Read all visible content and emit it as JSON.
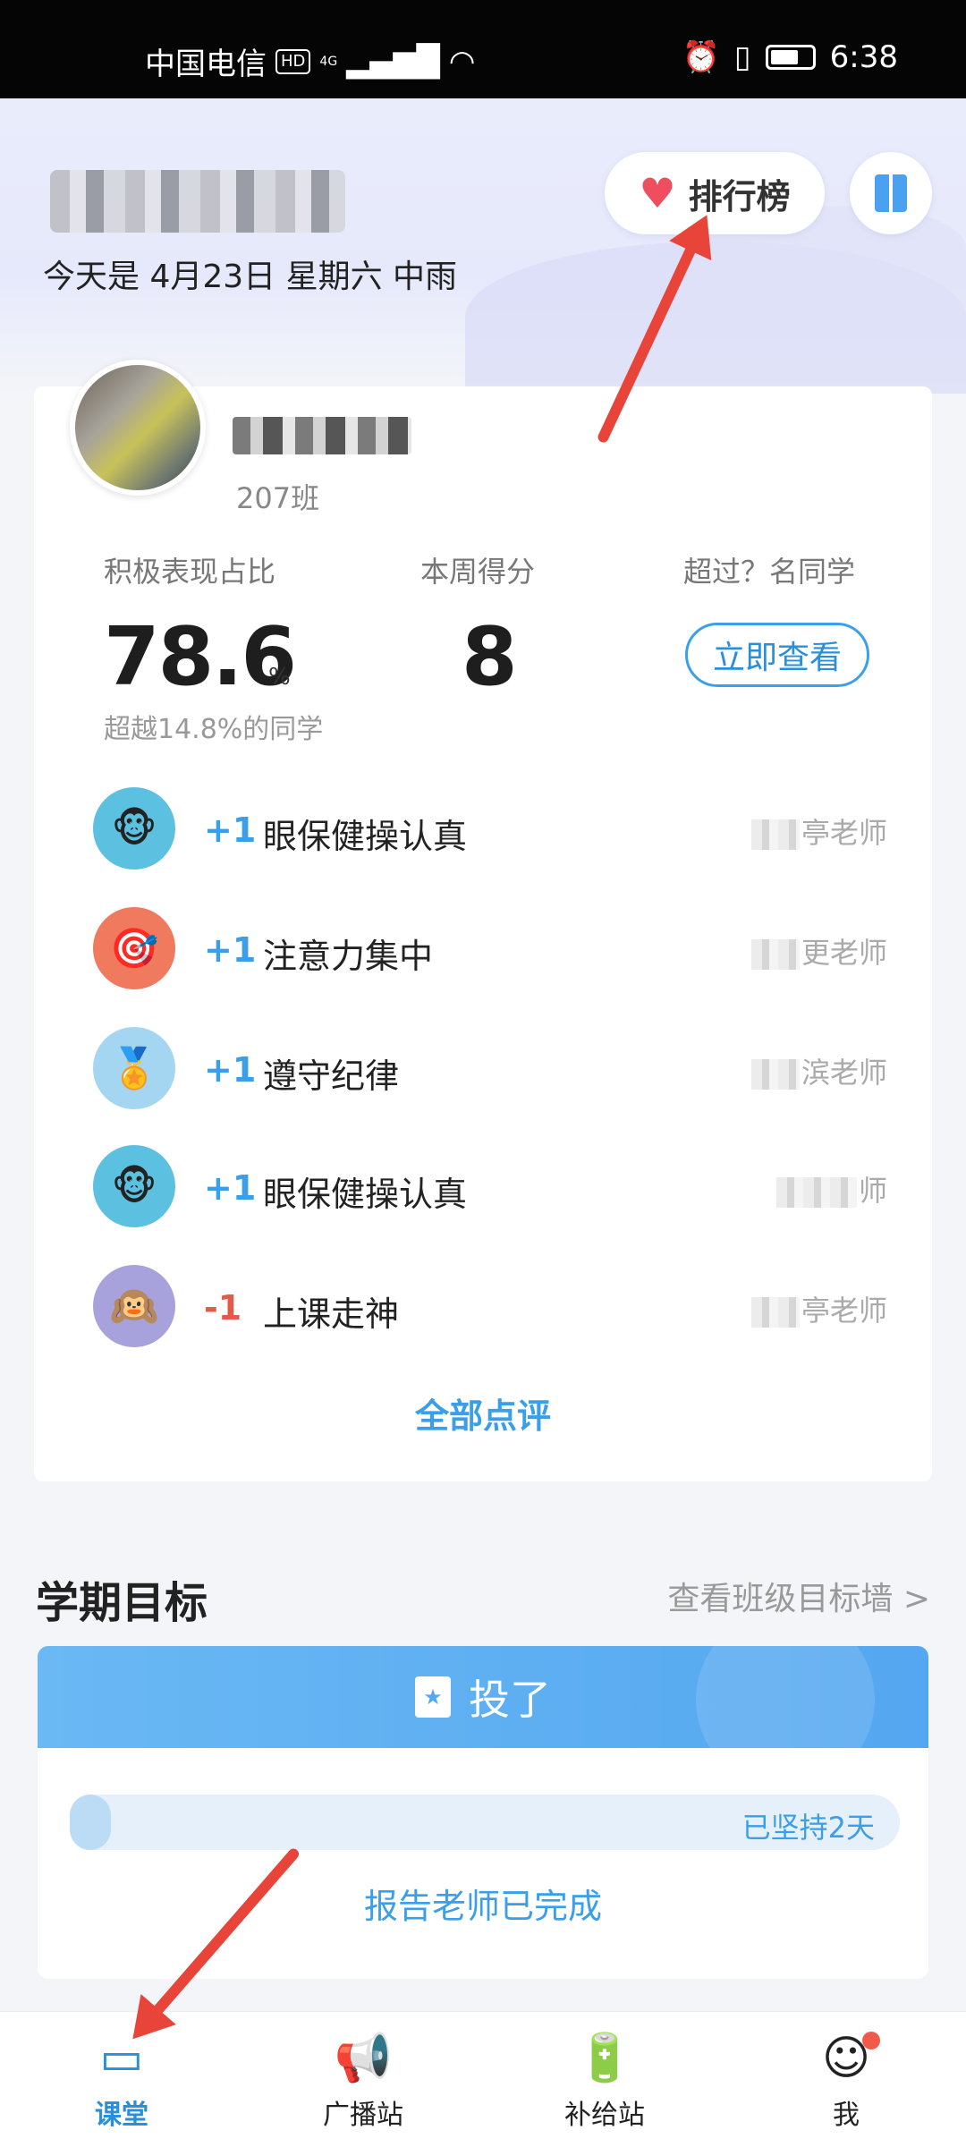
{
  "status_bar": {
    "carrier": "中国电信",
    "hd": "HD",
    "network": "4G",
    "time": "6:38"
  },
  "header": {
    "date_line": "今天是 4月23日 星期六 中雨",
    "ranking_label": "排行榜"
  },
  "profile": {
    "class_name": "207班"
  },
  "stats": {
    "ratio_title": "积极表现占比",
    "ratio_value": "78.6",
    "ratio_unit": "%",
    "ratio_sub": "超越14.8%的同学",
    "score_title": "本周得分",
    "score_value": "8",
    "exceed_title": "超过？名同学",
    "view_button": "立即查看"
  },
  "records": [
    {
      "score": "+1",
      "text": "眼保健操认真",
      "teacher_suffix": "亭老师",
      "icon": "monkey-icon"
    },
    {
      "score": "+1",
      "text": "注意力集中",
      "teacher_suffix": "更老师",
      "icon": "target-icon"
    },
    {
      "score": "+1",
      "text": "遵守纪律",
      "teacher_suffix": "滨老师",
      "icon": "medal-icon"
    },
    {
      "score": "+1",
      "text": "眼保健操认真",
      "teacher_suffix": "师",
      "icon": "monkey-icon"
    },
    {
      "score": "-1",
      "text": "上课走神",
      "teacher_suffix": "亭老师",
      "icon": "monkey-face-icon"
    }
  ],
  "all_comments": "全部点评",
  "goals": {
    "title": "学期目标",
    "wall_link": "查看班级目标墙 >",
    "goal_name": "投了",
    "progress_fraction": 0.05,
    "progress_label": "已坚持2天",
    "report_link": "报告老师已完成"
  },
  "nav": {
    "items": [
      {
        "label": "课堂",
        "icon": "classroom-icon"
      },
      {
        "label": "广播站",
        "icon": "megaphone-icon"
      },
      {
        "label": "补给站",
        "icon": "battery-icon"
      },
      {
        "label": "我",
        "icon": "profile-icon"
      }
    ]
  },
  "colors": {
    "accent": "#3a9ee8",
    "minus": "#e35a4a",
    "annotation_arrow": "#e9443a"
  }
}
